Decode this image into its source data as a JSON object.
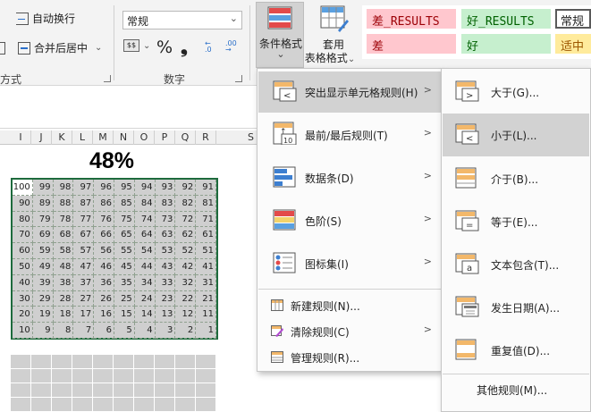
{
  "ribbon": {
    "wrap_text": "自动换行",
    "merge_center": "合并后居中",
    "align_group": "方式",
    "number_format": "常规",
    "number_group": "数字",
    "percent_symbol": "%",
    "comma_symbol": "❟",
    "cond_format_line1": "条件格式",
    "cond_format_arrow": "⌄",
    "table_format_line1": "套用",
    "table_format_line2": "表格格式",
    "table_format_arrow": "⌄",
    "styles": {
      "bad_results": "差_RESULTS",
      "good_results": "好_RESULTS",
      "normal": "常规",
      "bad": "差",
      "good": "好",
      "neutral": "适中"
    }
  },
  "sheet": {
    "columns": [
      "I",
      "J",
      "K",
      "L",
      "M",
      "N",
      "O",
      "P",
      "Q",
      "R",
      "S"
    ],
    "percent_label": "48%",
    "grid": [
      [
        100,
        99,
        98,
        97,
        96,
        95,
        94,
        93,
        92,
        91
      ],
      [
        90,
        89,
        88,
        87,
        86,
        85,
        84,
        83,
        82,
        81
      ],
      [
        80,
        79,
        78,
        77,
        76,
        75,
        74,
        73,
        72,
        71
      ],
      [
        70,
        69,
        68,
        67,
        66,
        65,
        64,
        63,
        62,
        61
      ],
      [
        60,
        59,
        58,
        57,
        56,
        55,
        54,
        53,
        52,
        51
      ],
      [
        50,
        49,
        48,
        47,
        46,
        45,
        44,
        43,
        42,
        41
      ],
      [
        40,
        39,
        38,
        37,
        36,
        35,
        34,
        33,
        32,
        31
      ],
      [
        30,
        29,
        28,
        27,
        26,
        25,
        24,
        23,
        22,
        21
      ],
      [
        20,
        19,
        18,
        17,
        16,
        15,
        14,
        13,
        12,
        11
      ],
      [
        10,
        9,
        8,
        7,
        6,
        5,
        4,
        3,
        2,
        1
      ]
    ]
  },
  "menu1": {
    "items": [
      {
        "label": "突出显示单元格规则(H)",
        "icon": "highlight-cells-icon"
      },
      {
        "label": "最前/最后规则(T)",
        "icon": "top-bottom-icon"
      },
      {
        "label": "数据条(D)",
        "icon": "data-bars-icon"
      },
      {
        "label": "色阶(S)",
        "icon": "color-scales-icon"
      },
      {
        "label": "图标集(I)",
        "icon": "icon-sets-icon"
      }
    ],
    "small_items": [
      {
        "label": "新建规则(N)...",
        "icon": "new-rule-icon"
      },
      {
        "label": "清除规则(C)",
        "icon": "clear-rules-icon"
      },
      {
        "label": "管理规则(R)...",
        "icon": "manage-rules-icon"
      }
    ]
  },
  "menu2": {
    "items": [
      {
        "label": "大于(G)...",
        "icon": "greater-than-icon"
      },
      {
        "label": "小于(L)...",
        "icon": "less-than-icon"
      },
      {
        "label": "介于(B)...",
        "icon": "between-icon"
      },
      {
        "label": "等于(E)...",
        "icon": "equal-to-icon"
      },
      {
        "label": "文本包含(T)...",
        "icon": "text-contains-icon"
      },
      {
        "label": "发生日期(A)...",
        "icon": "date-occurring-icon"
      },
      {
        "label": "重复值(D)...",
        "icon": "duplicate-values-icon"
      }
    ],
    "more_rules": "其他规则(M)..."
  },
  "colors": {
    "accent_green": "#1e6b3d",
    "bad_fill": "#ffc7ce",
    "bad_text": "#9c0006",
    "good_fill": "#c6efce",
    "good_text": "#006100",
    "neutral_fill": "#ffeb9c",
    "neutral_text": "#9c5700",
    "menu_highlight": "#d2d2d2"
  }
}
